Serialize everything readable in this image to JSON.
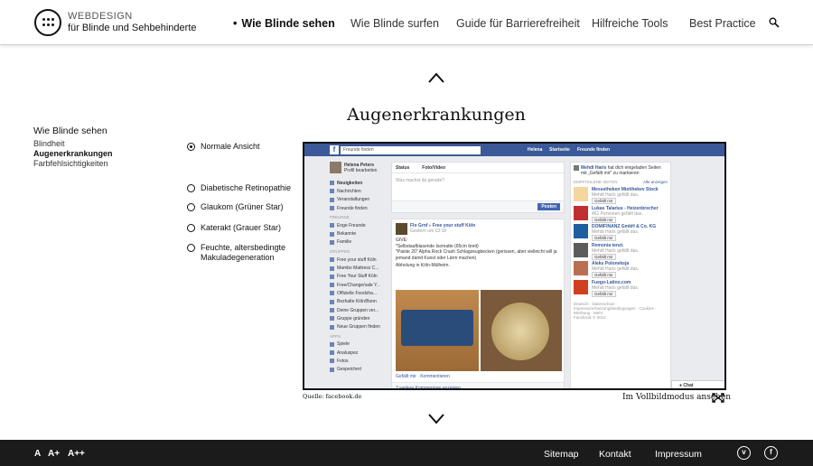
{
  "logo": {
    "line1": "WEBDESIGN",
    "line2": "für Blinde und Sehbehinderte"
  },
  "nav": {
    "items": [
      {
        "label": "Wie Blinde sehen"
      },
      {
        "label": "Wie Blinde surfen"
      },
      {
        "label": "Guide für Barrierefreiheit"
      },
      {
        "label": "Hilfreiche Tools"
      },
      {
        "label": "Best Practice"
      }
    ],
    "active_index": 0,
    "search_icon": "search-icon"
  },
  "sidebar": {
    "section": "Wie Blinde sehen",
    "items": [
      {
        "label": "Blindheit"
      },
      {
        "label": "Augenerkrankungen"
      },
      {
        "label": "Farbfehlsichtigkeiten"
      }
    ],
    "current_index": 1
  },
  "main": {
    "title": "Augenerkrankungen",
    "up_arrow_icon": "chevron-up-icon",
    "down_arrow_icon": "chevron-down-icon",
    "options": [
      {
        "label": "Normale Ansicht",
        "selected": true
      },
      {
        "label": "Diabetische Retinopathie",
        "selected": false
      },
      {
        "label": "Glaukom (Grüner Star)",
        "selected": false
      },
      {
        "label": "Katerakt (Grauer Star)",
        "selected": false
      },
      {
        "label": "Feuchte, altersbedingte Makuladegeneration",
        "selected": false
      }
    ],
    "source": "Quelle: facebook.de",
    "fullscreen": "Im Vollbildmodus ansehen",
    "fullscreen_icon": "expand-arrows-icon"
  },
  "fb": {
    "logo": "f",
    "search": "Freunde finden",
    "top_nav": [
      "Helena",
      "Startseite",
      "Freunde finden"
    ],
    "profile_name": "Helena Peters",
    "profile_edit": "Profil bearbeiten",
    "left_items": [
      "Neuigkeiten",
      "Nachrichten",
      "Veranstaltungen",
      "Freunde finden"
    ],
    "friends_header": "FREUNDE",
    "friends_items": [
      "Enge Freunde",
      "Bekannte",
      "Familie"
    ],
    "groups_header": "GRUPPEN",
    "groups_items": [
      "Free your stuff Köln",
      "Mambo Mattress C...",
      "Free Your Stuff Köln",
      "Free/Change/sale Y...",
      "Offizielle Foodsha...",
      "Bezhalte Köln/Bonn",
      "Deine Gruppen ver...",
      "Gruppe gründen",
      "Neue Gruppen finden"
    ],
    "apps_header": "APPS",
    "apps_items": [
      "Spiele",
      "Analuspez",
      "Fotos",
      "Gespeichert"
    ],
    "composer_tabs": [
      "Status",
      "Foto/Video"
    ],
    "composer_placeholder": "Was machst du gerade?",
    "post_button": "Posten",
    "post_author": "Flo Grnf",
    "post_group": "Free your stuff Köln",
    "post_time": "Gestern um 13:18",
    "post_text": [
      "GIVE:",
      "*Selbstaufblasende Isomatte (65cm breit)",
      "*Paiste 20\" Alpha Rock Crash Schlagzeugbecken (gerissen, aber vielleicht will ja jemand damit Kunst oder Lärm machen)",
      "Abholung in Köln-Mülheim."
    ],
    "post_actions": "Gefällt mir · Kommentieren",
    "post_comments": "2 weitere Kommentare anzeigen",
    "right_top_name": "Mehdi Haris",
    "right_top_text": "hat dich eingeladen Seiten mit „Gefällt mir\" zu markieren",
    "suggested_header": "EMPFOHLENE SEITEN",
    "suggested_all": "Alle anzeigen",
    "suggestions": [
      {
        "name": "Messetheken Mietthekev Stock",
        "meta": "Mehdi Haris gefällt das."
      },
      {
        "name": "Lukas Talarius - Heizenbrecher",
        "meta": "461 Personen gefällt das."
      },
      {
        "name": "DOMIFINANZ GmbH & Co. KG",
        "meta": "Mehdi Haris gefällt das."
      },
      {
        "name": "Remonia tenzt.",
        "meta": "Mehdi Haris gefällt das."
      },
      {
        "name": "Aleks Poloneksja",
        "meta": "Mehdi Haris gefällt das."
      },
      {
        "name": "Fuego-Latino.com",
        "meta": "Mehdi Haris gefällt das."
      }
    ],
    "like_label": "Gefällt mir",
    "right_footer": "Deutsch · Datenschutz · Impressum/Nutzungsbedingungen · Cookies · Werbung · Mehr",
    "copyright": "Facebook © 2014",
    "chat_label": "Chat"
  },
  "footer": {
    "sizes": [
      "A",
      "A+",
      "A++"
    ],
    "links": [
      "Sitemap",
      "Kontakt",
      "Impressum"
    ],
    "icons": [
      "vimeo-icon",
      "facebook-icon"
    ]
  }
}
